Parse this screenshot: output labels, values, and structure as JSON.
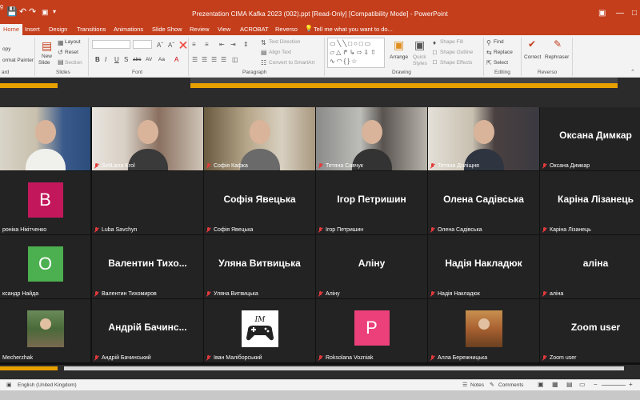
{
  "titlebar": {
    "title": "Prezentation CIMA Kafka 2023 (002).ppt [Read-Only] [Compatibility Mode] - PowerPoint",
    "left_fragment": "g"
  },
  "ribbon_tabs": [
    "Home",
    "Insert",
    "Design",
    "Transitions",
    "Animations",
    "Slide Show",
    "Review",
    "View",
    "ACROBAT",
    "Reverso"
  ],
  "tell_me": "Tell me what you want to do...",
  "ribbon": {
    "clipboard": {
      "copy": "opy",
      "format_painter": "ormat Painter",
      "label": "ard"
    },
    "slides": {
      "new_slide": "New",
      "new_slide_2": "Slide",
      "layout": "Layout",
      "reset": "Reset",
      "section": "Section",
      "label": "Slides"
    },
    "font": {
      "label": "Font",
      "bold": "B",
      "italic": "I",
      "underline": "U",
      "strike": "S",
      "shadow": "abc",
      "spacing": "AV",
      "case": "Aa",
      "color": "A"
    },
    "paragraph": {
      "text_direction": "Text Direction",
      "align_text": "Align Text",
      "smartart": "Convert to SmartArt",
      "label": "Paragraph"
    },
    "drawing": {
      "arrange": "Arrange",
      "quick_styles": "Quick",
      "quick_styles_2": "Styles",
      "shape_fill": "Shape Fill",
      "shape_outline": "Shape Outline",
      "shape_effects": "Shape Effects",
      "label": "Drawing"
    },
    "editing": {
      "find": "Find",
      "replace": "Replace",
      "select": "Select",
      "label": "Editing"
    },
    "reverso": {
      "correct": "Correct",
      "rephraser": "Rephraser",
      "label": "Reverso"
    }
  },
  "participants": [
    {
      "label": "",
      "type": "video",
      "active": true
    },
    {
      "label": "SvitLana Krol",
      "type": "video"
    },
    {
      "label": "Софія Кафка",
      "type": "video"
    },
    {
      "label": "Тетяна Савчук",
      "type": "video"
    },
    {
      "label": "Тетяна Доліщня",
      "type": "video"
    },
    {
      "label": "Оксана Димкар",
      "type": "name",
      "big": "Оксана Димкар"
    },
    {
      "label": "роніка Нікітченко",
      "type": "avatar",
      "letter": "B",
      "color": "#c2185b"
    },
    {
      "label": "Luba Savchyn",
      "type": "blank"
    },
    {
      "label": "Софія Явецька",
      "type": "name",
      "big": "Софія Явецька"
    },
    {
      "label": "Ігор Петришин",
      "type": "name",
      "big": "Ігор Петришин"
    },
    {
      "label": "Олена Садівська",
      "type": "name",
      "big": "Олена Садівська"
    },
    {
      "label": "Каріна Лізанець",
      "type": "name",
      "big": "Каріна Лізанець"
    },
    {
      "label": "ксандр Найда",
      "type": "avatar",
      "letter": "О",
      "color": "#4caf50"
    },
    {
      "label": "Валентин Тихомиров",
      "type": "name",
      "big": "Валентин  Тихо..."
    },
    {
      "label": "Уляна Витвицька",
      "type": "name",
      "big": "Уляна Витвицька"
    },
    {
      "label": "Аліну",
      "type": "name",
      "big": "Аліну"
    },
    {
      "label": "Надія Накладюк",
      "type": "name",
      "big": "Надія Накладюк"
    },
    {
      "label": "аліна",
      "type": "name",
      "big": "аліна"
    },
    {
      "label": "Mecherzhak",
      "type": "photo"
    },
    {
      "label": "Андрій Бачинський",
      "type": "name",
      "big": "Андрій Бачинс..."
    },
    {
      "label": "Іван Малiборський",
      "type": "gamepad"
    },
    {
      "label": "Roksolana Vozniak",
      "type": "avatar",
      "letter": "P",
      "color": "#ec407a"
    },
    {
      "label": "Алла Бережницька",
      "type": "photo2"
    },
    {
      "label": "Zoom user",
      "type": "name",
      "big": "Zoom user"
    }
  ],
  "statusbar": {
    "language": "English (United Kingdom)",
    "notes": "Notes",
    "comments": "Comments"
  },
  "colors": {
    "ppt_accent": "#c43e1c",
    "active_speaker": "#f0e14a",
    "tile_bg": "#232323"
  }
}
